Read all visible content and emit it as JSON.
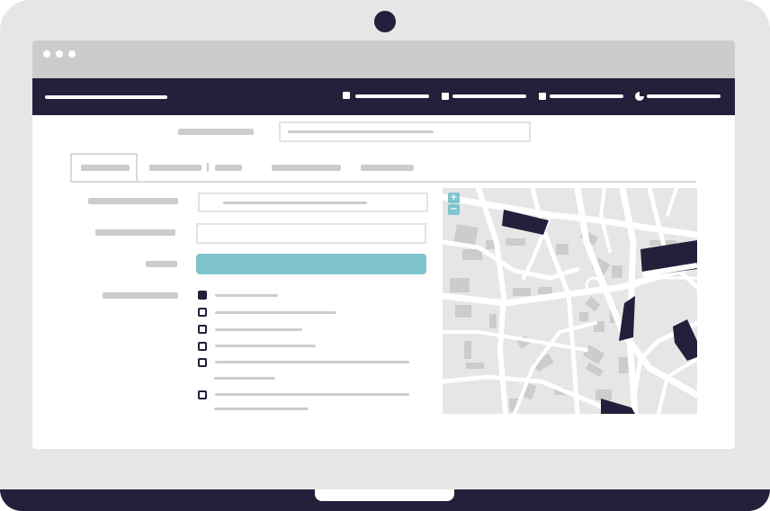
{
  "app": {
    "window_controls": [
      "close",
      "minimize",
      "maximize"
    ]
  },
  "navbar": {
    "items": [
      {
        "icon": "square-icon"
      },
      {
        "icon": "square-icon"
      },
      {
        "icon": "square-icon"
      },
      {
        "icon": "pie-chart-icon"
      }
    ]
  },
  "tabs": {
    "count": 4,
    "active_index": 0
  },
  "form": {
    "checkbox_states": [
      true,
      false,
      false,
      false,
      false,
      false
    ]
  },
  "map": {
    "zoom_in_label": "+",
    "zoom_out_label": "−",
    "search_icon": "magnifier-icon"
  },
  "colors": {
    "navbar": "#22203a",
    "accent": "#7fc4cc",
    "placeholder": "#cccccc",
    "map_background": "#e6e6e6",
    "map_roads": "#ffffff",
    "map_buildings": "#cccccc"
  }
}
